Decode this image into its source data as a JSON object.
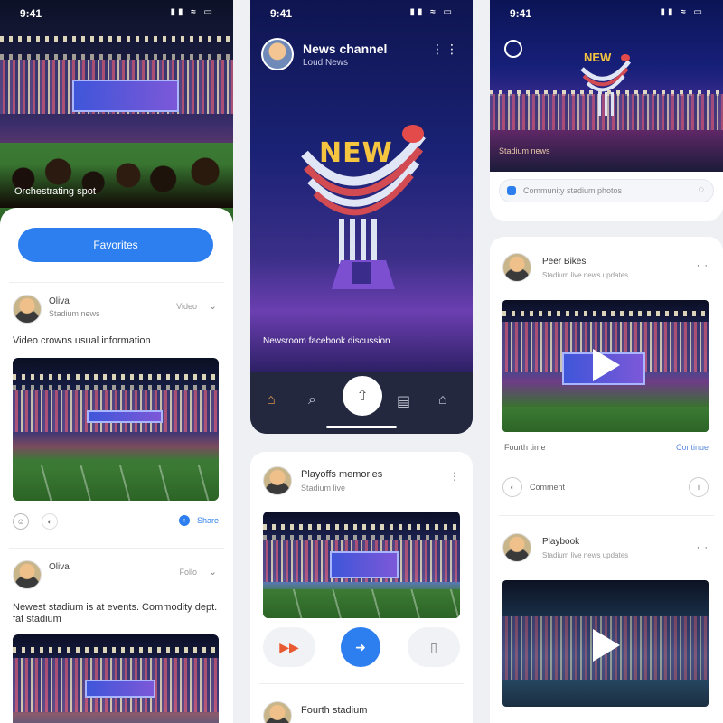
{
  "status": {
    "time": "9:41",
    "icons": "▮▮ ≈ ▭"
  },
  "col1": {
    "hero_caption": "Orchestrating spot",
    "primary_button": "Favorites",
    "posts": [
      {
        "name": "Oliva",
        "sub": "Stadium news",
        "meta": "Video",
        "text": "Video crowns usual information"
      },
      {
        "name": "Oliva",
        "sub": "",
        "meta": "Follo",
        "text": "Newest stadium is at events. Commodity dept. fat stadium"
      }
    ],
    "reaction_link": "Share"
  },
  "col2": {
    "title": "News channel",
    "subtitle": "Loud News",
    "logo_text": "NEW",
    "caption": "Newsroom facebook discussion",
    "nav": [
      "⌂",
      "⌕",
      "⇧",
      "▤",
      "⌂"
    ],
    "card": {
      "name": "Playoffs memories",
      "sub": "Stadium live"
    },
    "card2": {
      "name": "Fourth stadium"
    }
  },
  "col3": {
    "logo_text": "NEW",
    "caption": "Stadium news",
    "search_placeholder": "Community stadium photos",
    "posts": [
      {
        "name": "Peer Bikes",
        "sub": "Stadium live news updates",
        "caption_left": "Fourth time",
        "caption_right": "Continue",
        "comment": "Comment"
      },
      {
        "name": "Playbook",
        "sub": "Stadium live news updates"
      }
    ],
    "more": "· ·"
  },
  "colors": {
    "accent": "#2d7ff0",
    "gold": "#f6c540",
    "navy": "#1a1e52"
  }
}
